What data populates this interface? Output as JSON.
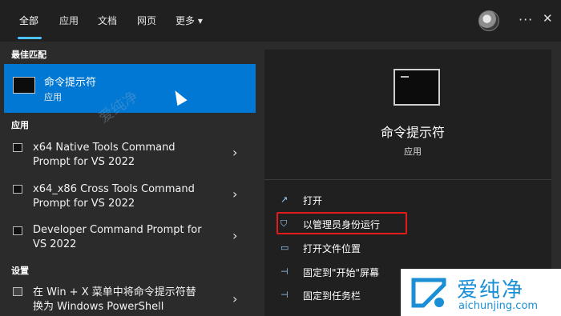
{
  "tabs": [
    {
      "label": "全部"
    },
    {
      "label": "应用"
    },
    {
      "label": "文档"
    },
    {
      "label": "网页"
    },
    {
      "label": "更多"
    }
  ],
  "more_arrow": "▾",
  "top_icons": {
    "more_options": "···",
    "close": "✕"
  },
  "left": {
    "best_match_header": "最佳匹配",
    "best_match": {
      "title": "命令提示符",
      "subtitle": "应用"
    },
    "apps_header": "应用",
    "apps": [
      {
        "text": "x64 Native Tools Command\nPrompt for VS 2022"
      },
      {
        "text": "x64_x86 Cross Tools Command\nPrompt for VS 2022"
      },
      {
        "text": "Developer Command Prompt for\nVS 2022"
      }
    ],
    "settings_header": "设置",
    "settings_items": [
      {
        "text": "在 Win + X 菜单中将命令提示符替\n换为 Windows PowerShell"
      }
    ]
  },
  "right": {
    "title": "命令提示符",
    "subtitle": "应用",
    "actions": [
      {
        "label": "打开",
        "icon": "open-icon"
      },
      {
        "label": "以管理员身份运行",
        "icon": "shield-icon"
      },
      {
        "label": "打开文件位置",
        "icon": "folder-icon"
      },
      {
        "label": "固定到\"开始\"屏幕",
        "icon": "pin-icon"
      },
      {
        "label": "固定到任务栏",
        "icon": "pin-icon"
      }
    ]
  },
  "watermark": "爱纯净",
  "logo": {
    "cn": "爱纯净",
    "en": "aichunjing.com"
  },
  "colors": {
    "accent": "#0078d4",
    "highlight": "#e31b1b",
    "logo": "#1a8fd6"
  }
}
